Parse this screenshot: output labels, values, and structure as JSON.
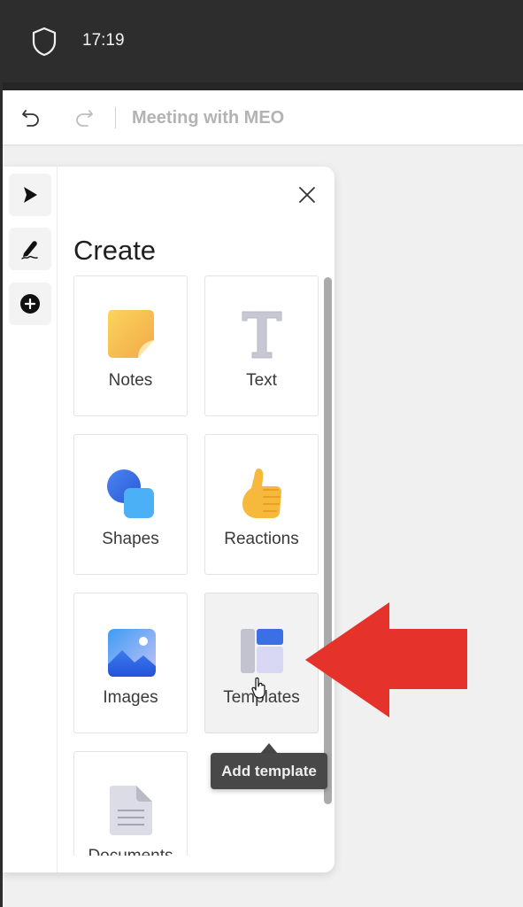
{
  "status_bar": {
    "time": "17:19",
    "icon": "shield-icon"
  },
  "titlebar": {
    "undo_icon": "undo-icon",
    "redo_icon": "redo-icon",
    "title": "Meeting with MEO"
  },
  "toolrail": {
    "items": [
      {
        "name": "select",
        "icon": "pointer-arrow-icon"
      },
      {
        "name": "pen",
        "icon": "pen-icon"
      },
      {
        "name": "add",
        "icon": "plus-circle-icon"
      }
    ]
  },
  "create_panel": {
    "title": "Create",
    "close_icon": "close-icon",
    "items": [
      {
        "label": "Notes",
        "icon": "sticky-note-icon"
      },
      {
        "label": "Text",
        "icon": "text-icon"
      },
      {
        "label": "Shapes",
        "icon": "shapes-icon"
      },
      {
        "label": "Reactions",
        "icon": "thumbs-up-icon"
      },
      {
        "label": "Images",
        "icon": "image-icon"
      },
      {
        "label": "Templates",
        "icon": "template-icon"
      },
      {
        "label": "Documents",
        "icon": "document-icon"
      }
    ],
    "hovered_item": "Templates"
  },
  "tooltip": {
    "text": "Add template"
  },
  "annotation": {
    "type": "arrow",
    "direction": "left",
    "color": "#e5322a",
    "points_to": "Templates"
  }
}
